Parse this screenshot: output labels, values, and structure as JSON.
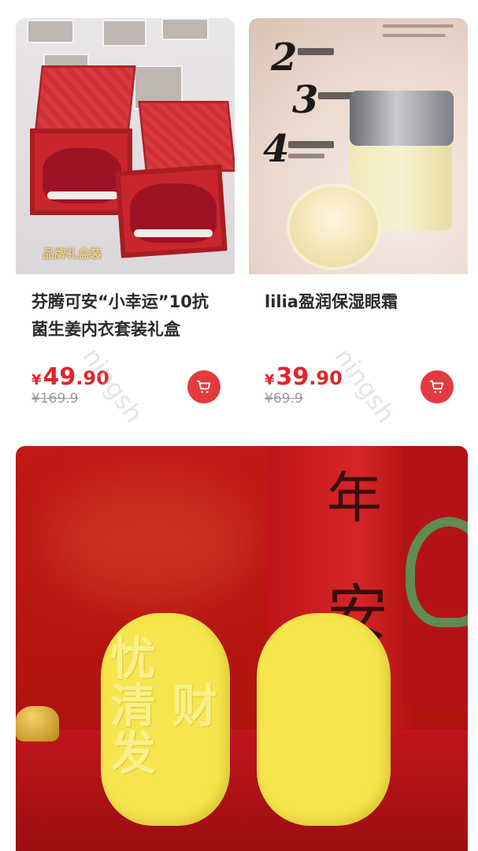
{
  "products": [
    {
      "title": "芬腾可安“小幸运”10抗菌生姜内衣套装礼盒",
      "price_currency": "¥",
      "price_integer": "49",
      "price_decimal": ".90",
      "original_price": "¥169.9",
      "image_tag": "品牌礼盒装"
    },
    {
      "title": "lilia盈润保湿眼霜",
      "price_currency": "¥",
      "price_integer": "39",
      "price_decimal": ".90",
      "original_price": "¥69.9"
    }
  ],
  "watermark": "ningsh",
  "colors": {
    "price": "#e3242b",
    "cart_button": "#e23a3f",
    "banner_red": "#c21a17",
    "gold": "#f6e54e"
  },
  "icons": {
    "cart": "shopping-cart-icon"
  }
}
